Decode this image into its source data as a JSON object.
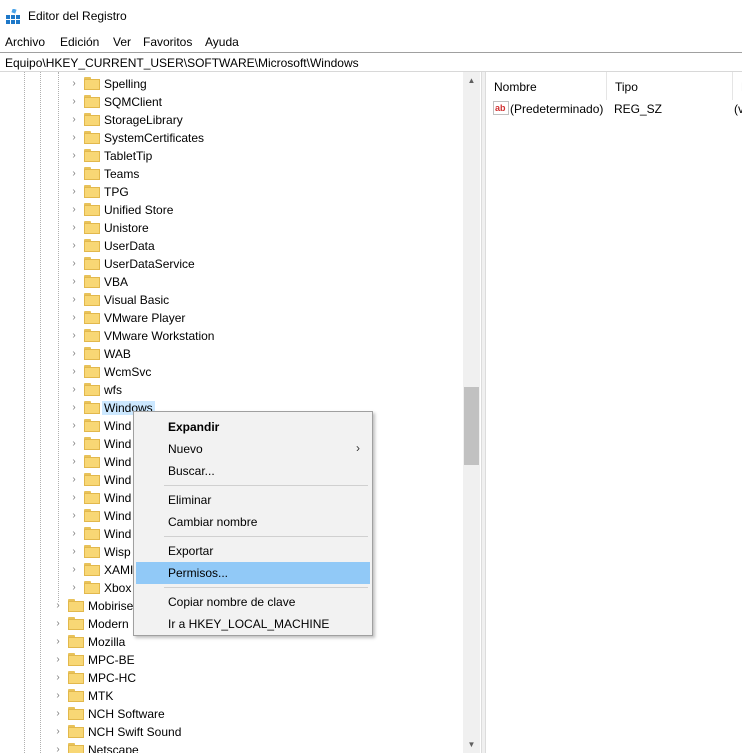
{
  "window": {
    "title": "Editor del Registro"
  },
  "menu": [
    "Archivo",
    "Edición",
    "Ver",
    "Favoritos",
    "Ayuda"
  ],
  "address": "Equipo\\HKEY_CURRENT_USER\\SOFTWARE\\Microsoft\\Windows",
  "tree": {
    "items": [
      "Spelling",
      "SQMClient",
      "StorageLibrary",
      "SystemCertificates",
      "TabletTip",
      "Teams",
      "TPG",
      "Unified Store",
      "Unistore",
      "UserData",
      "UserDataService",
      "VBA",
      "Visual Basic",
      "VMware Player",
      "VMware Workstation",
      "WAB",
      "WcmSvc",
      "wfs",
      "Windows",
      "Wind",
      "Wind",
      "Wind",
      "Wind",
      "Wind",
      "Wind",
      "Wind",
      "Wisp",
      "XAMI",
      "Xbox"
    ],
    "parent_items": [
      "Mobirise",
      "Modern",
      "Mozilla",
      "MPC-BE",
      "MPC-HC",
      "MTK",
      "NCH Software",
      "NCH Swift Sound",
      "Netscape"
    ],
    "selected": "Windows"
  },
  "values": {
    "columns": [
      "Nombre",
      "Tipo",
      "D"
    ],
    "rows": [
      {
        "name": "(Predeterminado)",
        "type": "REG_SZ",
        "data": "(v"
      }
    ]
  },
  "context_menu": {
    "items": [
      "Expandir",
      "Nuevo",
      "Buscar...",
      "Eliminar",
      "Cambiar nombre",
      "Exportar",
      "Permisos...",
      "Copiar nombre de clave",
      "Ir a HKEY_LOCAL_MACHINE"
    ],
    "highlighted": "Permisos..."
  },
  "icons": {
    "app": "registry-editor-icon",
    "folder": "folder-icon",
    "value": "string-value-icon"
  },
  "colors": {
    "selection": "#cce8ff",
    "menu_highlight": "#91c9f7",
    "folder": "#f8d775"
  }
}
